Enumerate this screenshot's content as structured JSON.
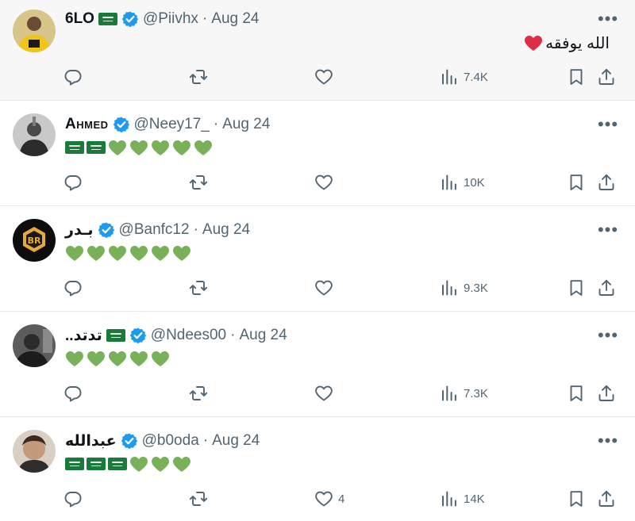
{
  "tweets": [
    {
      "name": "6LO",
      "handle": "@Piivhx",
      "dot": "·",
      "date": "Aug 24",
      "text": "الله يوفقه",
      "views": "7.4K",
      "likes": "",
      "avatar_color": "#e2b73a"
    },
    {
      "name": "Ahmed",
      "handle": "@Neey17_",
      "dot": "·",
      "date": "Aug 24",
      "views": "10K",
      "likes": "",
      "avatar_color": "#6b6b6b"
    },
    {
      "name": "بـدر",
      "handle": "@Banfc12",
      "dot": "·",
      "date": "Aug 24",
      "views": "9.3K",
      "likes": "",
      "avatar_color": "#111111"
    },
    {
      "name": "..تدتد",
      "handle": "@Ndees00",
      "dot": "·",
      "date": "Aug 24",
      "views": "7.3K",
      "likes": "",
      "avatar_color": "#3a3a3a"
    },
    {
      "name": "عبدالله",
      "handle": "@b0oda",
      "dot": "·",
      "date": "Aug 24",
      "views": "14K",
      "likes": "4",
      "avatar_color": "#4a3a2e"
    }
  ],
  "icons": {
    "reply": "reply-icon",
    "retweet": "retweet-icon",
    "like": "heart-icon",
    "views": "views-icon",
    "bookmark": "bookmark-icon",
    "share": "share-icon",
    "more": "more-icon",
    "verified": "verified-badge-icon"
  },
  "colors": {
    "verified": "#1d9bf0",
    "green_heart": "#78b159",
    "red_heart": "#dd2e44",
    "muted": "#536471"
  }
}
